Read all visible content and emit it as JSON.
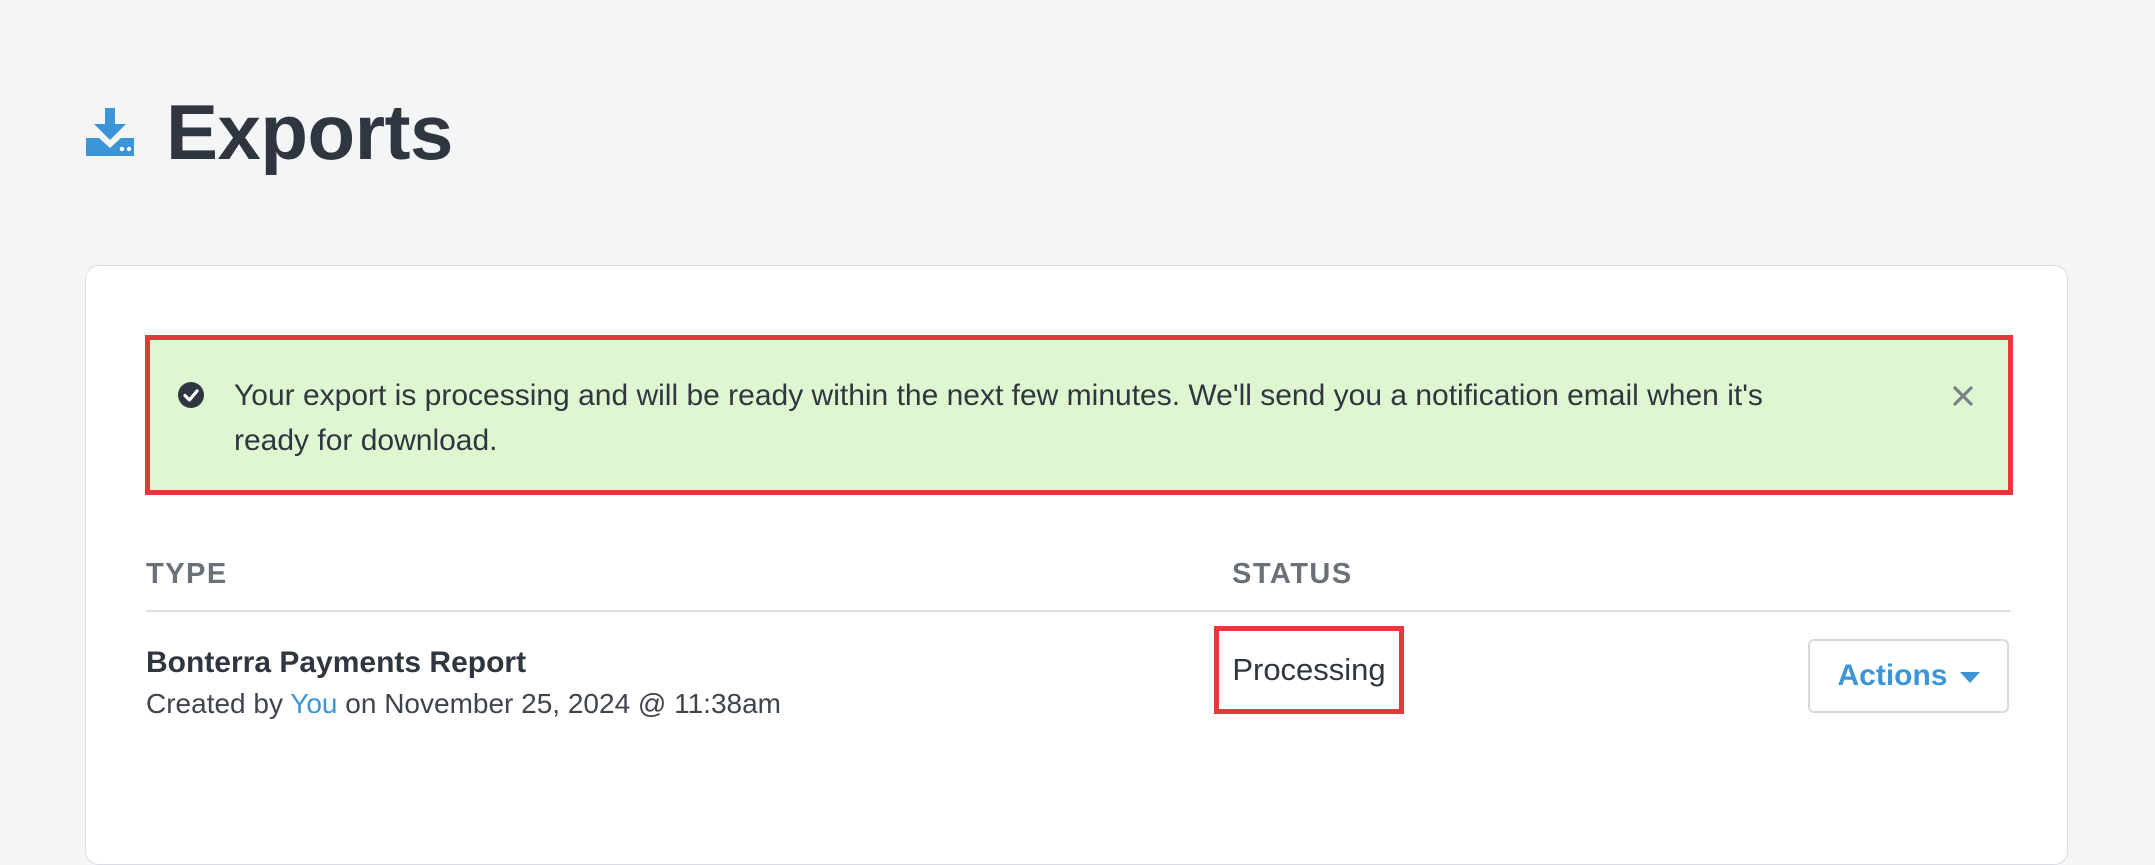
{
  "header": {
    "icon": "download-icon",
    "title": "Exports"
  },
  "alert": {
    "icon": "check-circle-icon",
    "message": "Your export is processing and will be ready within the next few minutes. We'll send you a notification email when it's ready for download.",
    "close_icon": "close-icon",
    "background_color": "#dff7d0",
    "highlight_color": "#e03a3a"
  },
  "table": {
    "columns": [
      "TYPE",
      "STATUS"
    ],
    "rows": [
      {
        "name": "Bonterra Payments Report",
        "created_prefix": "Created by",
        "created_by": "You",
        "created_suffix": "on November 25, 2024 @ 11:38am",
        "status": "Processing",
        "actions_label": "Actions"
      }
    ]
  },
  "colors": {
    "accent": "#3b95d6",
    "text": "#2f3640",
    "page_background": "#f4f5f7"
  }
}
